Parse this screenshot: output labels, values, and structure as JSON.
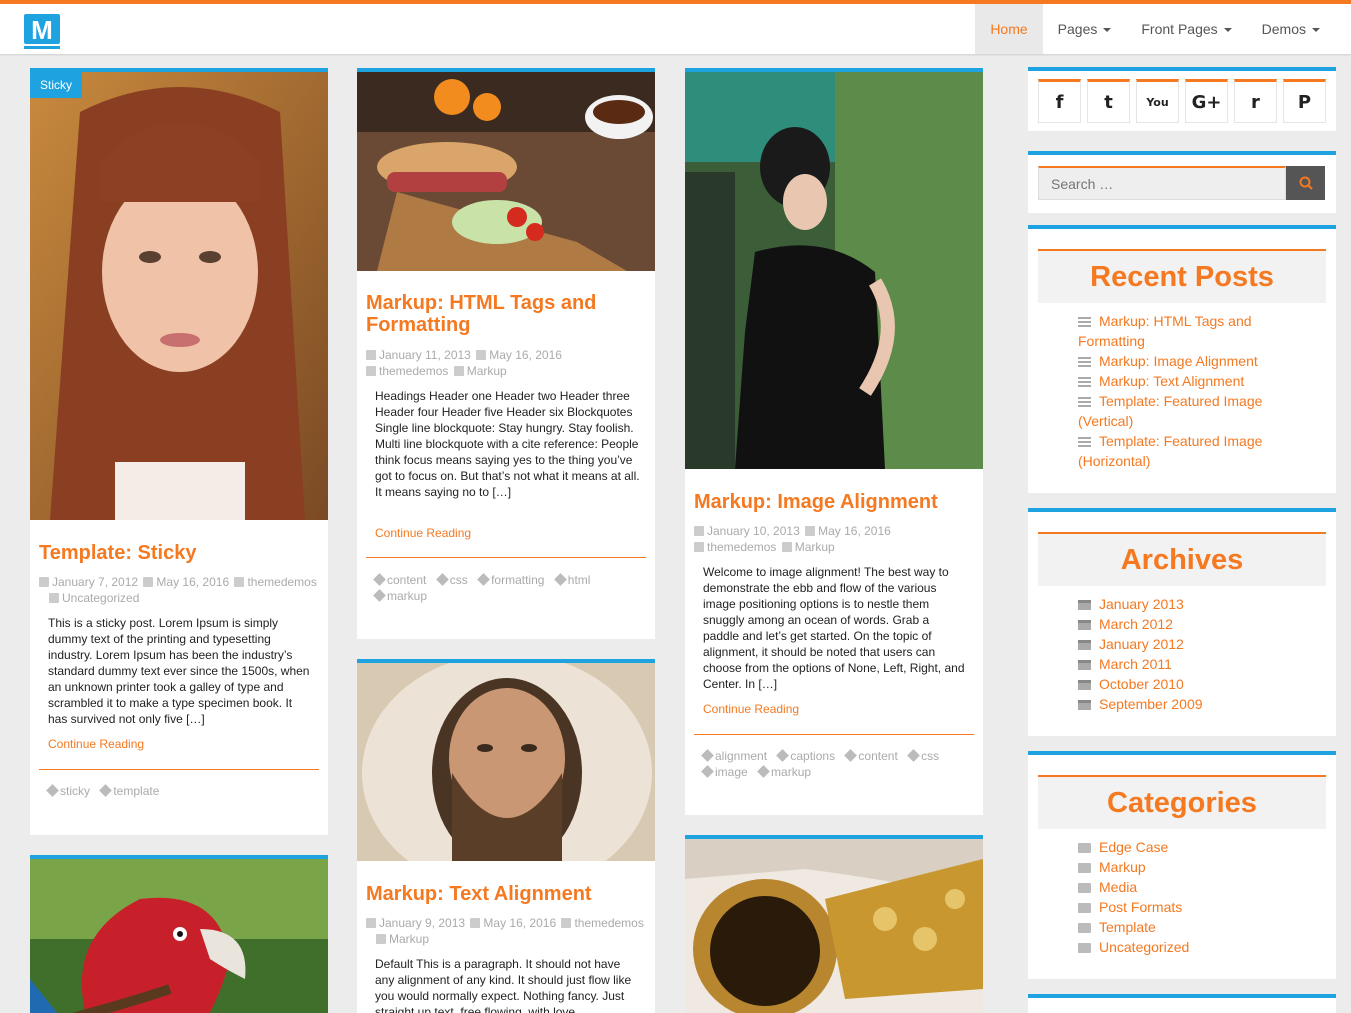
{
  "header": {
    "logo_text": "M",
    "nav": [
      {
        "label": "Home",
        "active": true,
        "dropdown": false
      },
      {
        "label": "Pages",
        "active": false,
        "dropdown": true
      },
      {
        "label": "Front Pages",
        "active": false,
        "dropdown": true
      },
      {
        "label": "Demos",
        "active": false,
        "dropdown": true
      }
    ]
  },
  "posts": {
    "sticky": {
      "badge": "Sticky",
      "title": "Template: Sticky",
      "date": "January 7, 2012",
      "modified": "May 16, 2016",
      "author": "themedemos",
      "category": "Uncategorized",
      "excerpt": "This is a sticky post.   Lorem Ipsum is simply dummy text of the printing and typesetting industry. Lorem Ipsum has been the industry’s standard dummy text ever since the 1500s, when an unknown printer took a galley of type and scrambled it to make a type specimen book. It has survived not only five […]",
      "read_more": "Continue Reading",
      "tags": [
        "sticky",
        "template"
      ]
    },
    "html_tags": {
      "title": "Markup: HTML Tags and Formatting",
      "date": "January 11, 2013",
      "modified": "May 16, 2016",
      "author": "themedemos",
      "category": "Markup",
      "excerpt": "Headings Header one Header two Header three Header four Header five Header six Blockquotes Single line blockquote: Stay hungry. Stay foolish. Multi line blockquote with a cite reference: People think focus means saying yes to the thing you’ve got to focus on. But that’s not what it means at all. It means saying no to […]",
      "read_more": "Continue Reading",
      "tags": [
        "content",
        "css",
        "formatting",
        "html",
        "markup"
      ]
    },
    "image_alignment": {
      "title": "Markup: Image Alignment",
      "date": "January 10, 2013",
      "modified": "May 16, 2016",
      "author": "themedemos",
      "category": "Markup",
      "excerpt": "Welcome to image alignment! The best way to demonstrate the ebb and flow of the various image positioning options is to nestle them snuggly among an ocean of words. Grab a paddle and let’s get started. On the topic of alignment, it should be noted that users can choose from the options of None, Left, Right, and Center. In […]",
      "read_more": "Continue Reading",
      "tags": [
        "alignment",
        "captions",
        "content",
        "css",
        "image",
        "markup"
      ]
    },
    "text_alignment": {
      "title": "Markup: Text Alignment",
      "date": "January 9, 2013",
      "modified": "May 16, 2016",
      "author": "themedemos",
      "category": "Markup",
      "excerpt": "Default This is a paragraph. It should not have any alignment of any kind. It should just flow like you would normally expect. Nothing fancy. Just straight up text, free flowing, with love."
    }
  },
  "sidebar": {
    "social_icons": [
      "facebook-icon",
      "twitter-icon",
      "youtube-icon",
      "google-plus-icon",
      "reddit-icon",
      "pinterest-icon"
    ],
    "social_glyphs": [
      "f",
      "t",
      "You",
      "G+",
      "r",
      "P"
    ],
    "search_placeholder": "Search …",
    "recent_posts": {
      "title": "Recent Posts",
      "items": [
        "Markup: HTML Tags and Formatting",
        "Markup: Image Alignment",
        "Markup: Text Alignment",
        "Template: Featured Image (Vertical)",
        "Template: Featured Image (Horizontal)"
      ]
    },
    "archives": {
      "title": "Archives",
      "items": [
        "January 2013",
        "March 2012",
        "January 2012",
        "March 2011",
        "October 2010",
        "September 2009"
      ]
    },
    "categories": {
      "title": "Categories",
      "items": [
        "Edge Case",
        "Markup",
        "Media",
        "Post Formats",
        "Template",
        "Uncategorized"
      ]
    }
  },
  "colors": {
    "accent": "#f47920",
    "secondary": "#1fa3e0",
    "background": "#ececec"
  }
}
